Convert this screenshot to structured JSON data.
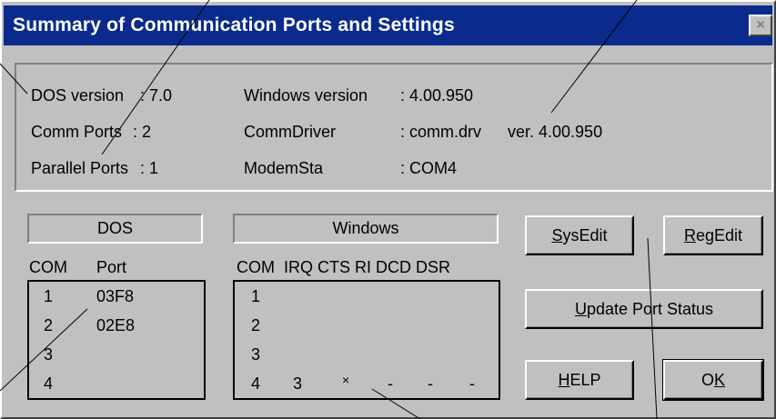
{
  "window": {
    "title": "Summary of Communication Ports and Settings",
    "close_glyph": "×"
  },
  "info": {
    "dos_version": {
      "label": "DOS version",
      "value": ": 7.0"
    },
    "comm_ports": {
      "label": "Comm Ports",
      "value": ": 2"
    },
    "parallel_ports": {
      "label": "Parallel Ports",
      "value": ": 1"
    },
    "windows_version": {
      "label": "Windows version",
      "value": ": 4.00.950"
    },
    "comm_driver": {
      "label": "CommDriver",
      "value": ": comm.drv",
      "ver": "ver. 4.00.950"
    },
    "modem_sta": {
      "label": "ModemSta",
      "value": ": COM4"
    }
  },
  "dos": {
    "header": "DOS",
    "col_com": "COM",
    "col_port": "Port",
    "rows": [
      {
        "com": "1",
        "port": "03F8"
      },
      {
        "com": "2",
        "port": "02E8"
      },
      {
        "com": "3",
        "port": ""
      },
      {
        "com": "4",
        "port": ""
      }
    ]
  },
  "windows": {
    "header": "Windows",
    "columns": "COM  IRQ CTS RI DCD DSR",
    "rows": [
      {
        "com": "1",
        "irq": "",
        "cts": "",
        "ri": "",
        "dcd": "",
        "dsr": ""
      },
      {
        "com": "2",
        "irq": "",
        "cts": "",
        "ri": "",
        "dcd": "",
        "dsr": ""
      },
      {
        "com": "3",
        "irq": "",
        "cts": "",
        "ri": "",
        "dcd": "",
        "dsr": ""
      },
      {
        "com": "4",
        "irq": "3",
        "cts": "×",
        "ri": "-",
        "dcd": "-",
        "dsr": "-"
      }
    ]
  },
  "buttons": {
    "sysedit": {
      "mnemonic": "S",
      "rest": "ysEdit"
    },
    "regedit": {
      "mnemonic": "R",
      "rest": "egEdit"
    },
    "update": {
      "mnemonic": "U",
      "rest": "pdate Port Status"
    },
    "help": {
      "mnemonic": "H",
      "rest": "ELP"
    },
    "ok": {
      "pre": "O",
      "mnemonic": "K"
    }
  }
}
